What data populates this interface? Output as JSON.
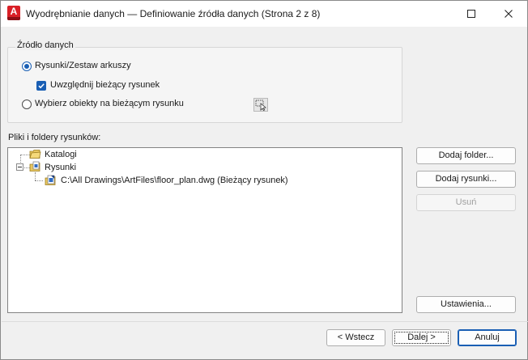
{
  "window": {
    "title": "Wyodrębnianie danych — Definiowanie źródła danych (Strona 2 z 8)",
    "app_icon_letter": "A",
    "accent_color": "#1a5fb4",
    "icon_color": "#d92027"
  },
  "data_source": {
    "group_label": "Źródło danych",
    "options": [
      {
        "label": "Rysunki/Zestaw arkuszy",
        "selected": true
      },
      {
        "label": "Wybierz obiekty na bieżącym rysunku",
        "selected": false
      }
    ],
    "include_current": {
      "label": "Uwzględnij bieżący rysunek",
      "checked": true
    },
    "pick_objects_icon": "select-objects-icon"
  },
  "files": {
    "label": "Pliki i foldery rysunków:",
    "tree": [
      {
        "label": "Katalogi",
        "icon": "folder-catalog-icon"
      },
      {
        "label": "Rysunki",
        "icon": "drawings-icon",
        "expanded": true,
        "children": [
          {
            "label": "C:\\All Drawings\\ArtFiles\\floor_plan.dwg (Bieżący rysunek)",
            "icon": "drawing-file-icon"
          }
        ]
      }
    ]
  },
  "side_buttons": {
    "add_folder": "Dodaj folder...",
    "add_drawings": "Dodaj rysunki...",
    "remove": "Usuń",
    "settings": "Ustawienia..."
  },
  "footer_buttons": {
    "back": "< Wstecz",
    "next": "Dalej >",
    "cancel": "Anuluj"
  }
}
